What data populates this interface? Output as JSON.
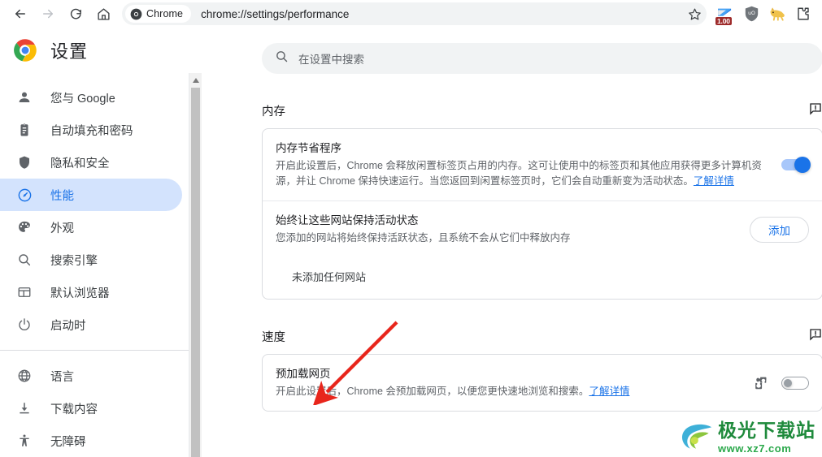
{
  "browser": {
    "nav": {
      "back": "back-arrow",
      "forward": "forward-arrow",
      "reload": "reload-icon",
      "home": "home-icon"
    },
    "omnibox": {
      "chip_label": "Chrome",
      "url": "chrome://settings/performance",
      "bookmark_icon": "star-icon"
    },
    "extensions": [
      {
        "name": "ext-badge-1.00",
        "badge": "1.00"
      },
      {
        "name": "ublock-origin-shield"
      },
      {
        "name": "cat-extension"
      },
      {
        "name": "extensions-puzzle"
      }
    ]
  },
  "settings": {
    "brand_title": "设置",
    "search": {
      "placeholder": "在设置中搜索",
      "value": ""
    },
    "sidebar": [
      {
        "label": "您与 Google",
        "icon": "person-icon",
        "active": false
      },
      {
        "label": "自动填充和密码",
        "icon": "clipboard-icon",
        "active": false
      },
      {
        "label": "隐私和安全",
        "icon": "shield-icon",
        "active": false
      },
      {
        "label": "性能",
        "icon": "speedometer-icon",
        "active": true
      },
      {
        "label": "外观",
        "icon": "palette-icon",
        "active": false
      },
      {
        "label": "搜索引擎",
        "icon": "search-icon",
        "active": false
      },
      {
        "label": "默认浏览器",
        "icon": "browser-window-icon",
        "active": false
      },
      {
        "label": "启动时",
        "icon": "power-icon",
        "active": false
      },
      {
        "label": "语言",
        "icon": "globe-icon",
        "active": false
      },
      {
        "label": "下载内容",
        "icon": "download-icon",
        "active": false
      },
      {
        "label": "无障碍",
        "icon": "accessibility-icon",
        "active": false
      }
    ],
    "sections": {
      "memory": {
        "heading": "内存",
        "feedback_icon": "feedback-icon",
        "memory_saver": {
          "title": "内存节省程序",
          "description": "开启此设置后，Chrome 会释放闲置标签页占用的内存。这可让使用中的标签页和其他应用获得更多计算机资源，并让 Chrome 保持快速运行。当您返回到闲置标签页时，它们会自动重新变为活动状态。",
          "learn_more": "了解详情",
          "toggle_state": "on"
        },
        "always_active": {
          "title": "始终让这些网站保持活动状态",
          "description": "您添加的网站将始终保持活跃状态，且系统不会从它们中释放内存",
          "add_button": "添加",
          "empty_text": "未添加任何网站"
        }
      },
      "speed": {
        "heading": "速度",
        "feedback_icon": "feedback-icon",
        "preload": {
          "title": "预加载网页",
          "description": "开启此设置后，Chrome 会预加载网页，以便您更快速地浏览和搜索。",
          "learn_more": "了解详情",
          "extension_icon": "puzzle-icon",
          "toggle_state": "off"
        }
      }
    }
  },
  "annotation": {
    "arrow": "red-arrow-pointing-to-preload"
  },
  "watermark": {
    "main": "极光下载站",
    "sub": "www.xz7.com"
  },
  "colors": {
    "accent": "#1a73e8",
    "active_pill": "#d3e3fd",
    "text_primary": "#202124",
    "text_secondary": "#5f6368",
    "border": "#dadce0",
    "arrow_red": "#e8261c",
    "watermark_green": "#1f8a3c"
  }
}
